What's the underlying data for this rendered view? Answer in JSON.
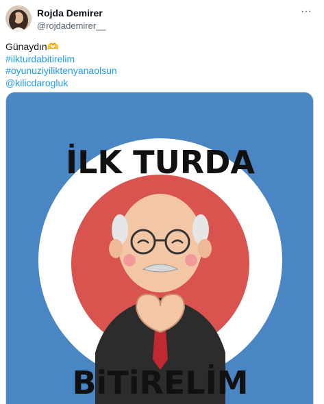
{
  "author": {
    "display_name": "Rojda Demirer",
    "handle": "@rojdademirer__"
  },
  "menu": {
    "more_icon": "more-horizontal-icon",
    "more_label": "···"
  },
  "tweet": {
    "text_lines": [
      "Günaydın🫶",
      "#ilkturdabitirelim",
      "#oyunuziyiliktenyanaolsun",
      "@kilicdarogluk"
    ]
  },
  "media": {
    "lettering_top": "İLK TURDA",
    "lettering_bottom": "BiTiRELİM",
    "colors": {
      "background": "#4b86c4",
      "ring": "#ffffff",
      "inner_red": "#d9534f"
    }
  }
}
